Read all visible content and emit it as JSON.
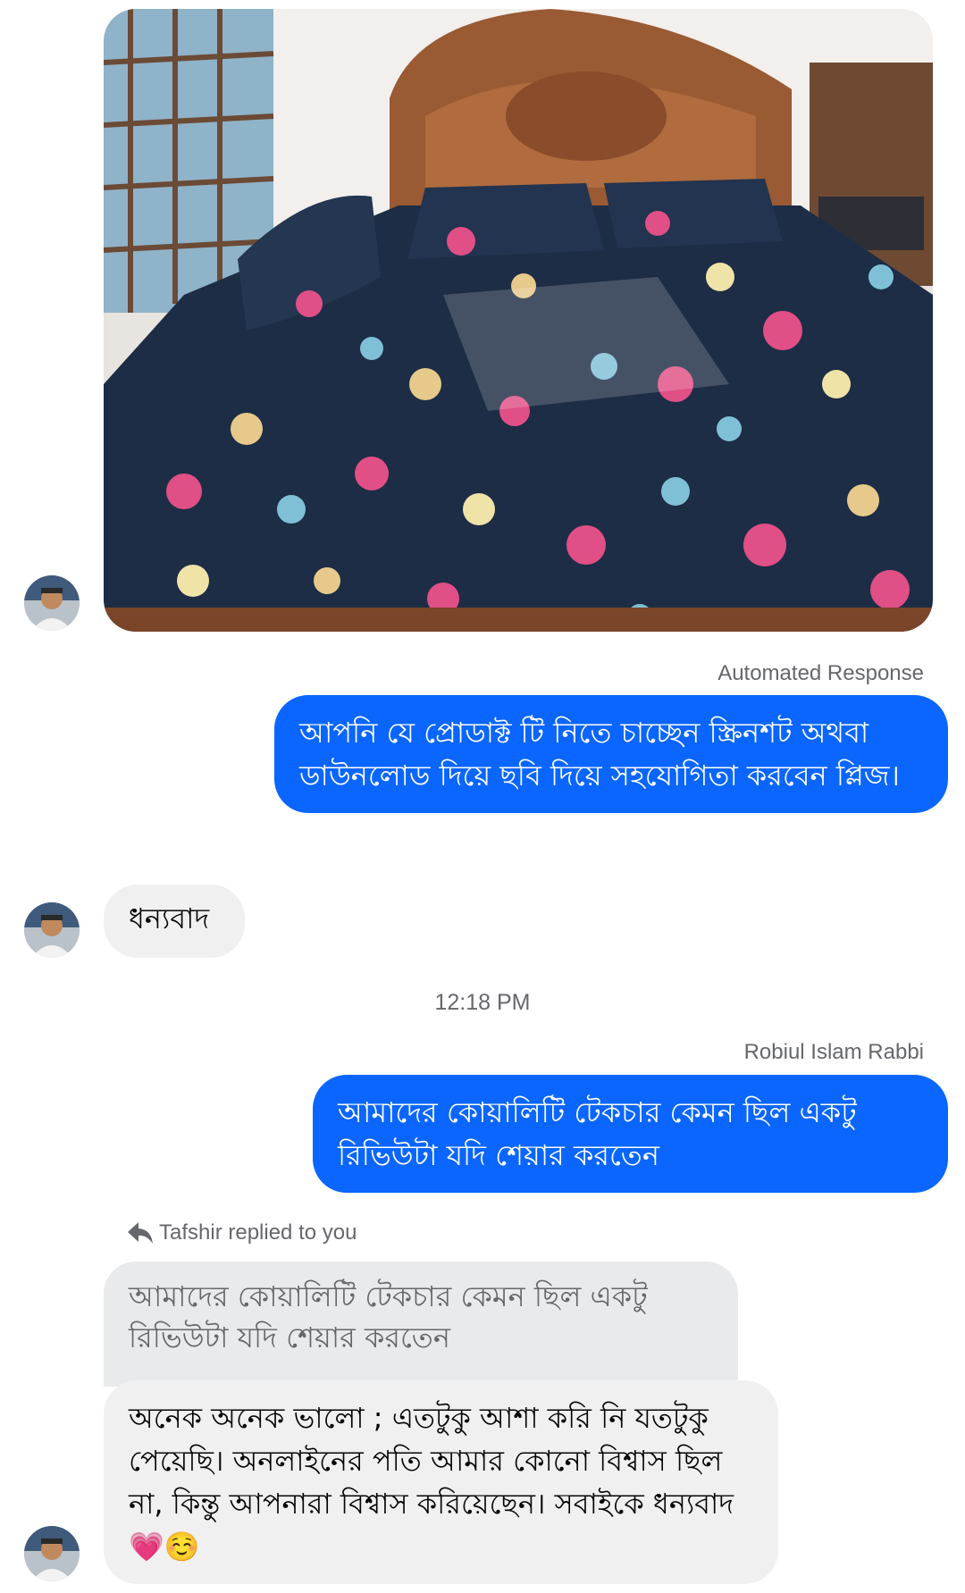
{
  "messages": {
    "photo_caption": "",
    "automated_label": "Automated Response",
    "automated_text": "আপনি যে প্রোডাক্ট টি নিতে চাচ্ছেন স্ক্রিনশট অথবা ডাউনলোড দিয়ে ছবি দিয়ে সহযোগিতা করবেন প্লিজ।",
    "thanks_text": "ধন্যবাদ",
    "timestamp": "12:18 PM",
    "sender_name": "Robiul Islam Rabbi",
    "review_request": "আমাদের কোয়ালিটি টেকচার কেমন ছিল একটু রিভিউটা যদি শেয়ার করতেন",
    "reply_header": "Tafshir replied to you",
    "quoted_text": "আমাদের কোয়ালিটি টেকচার কেমন ছিল একটু রিভিউটা যদি শেয়ার করতেন",
    "reply_text": "অনেক অনেক ভালো ; এতটুকু আশা করি নি যতটুকু পেয়েছি। অনলাইনের পতি আমার কোনো বিশ্বাস ছিল না, কিন্তু আপনারা বিশ্বাস করিয়েছেন। সবাইকে ধন্যবাদ 💗☺️"
  },
  "colors": {
    "outgoing_bubble": "#0a66ff",
    "incoming_bubble": "#f0f0f0",
    "meta_text": "#65676b"
  },
  "icons": [
    "avatar",
    "reply-arrow-icon",
    "bed-photo"
  ]
}
